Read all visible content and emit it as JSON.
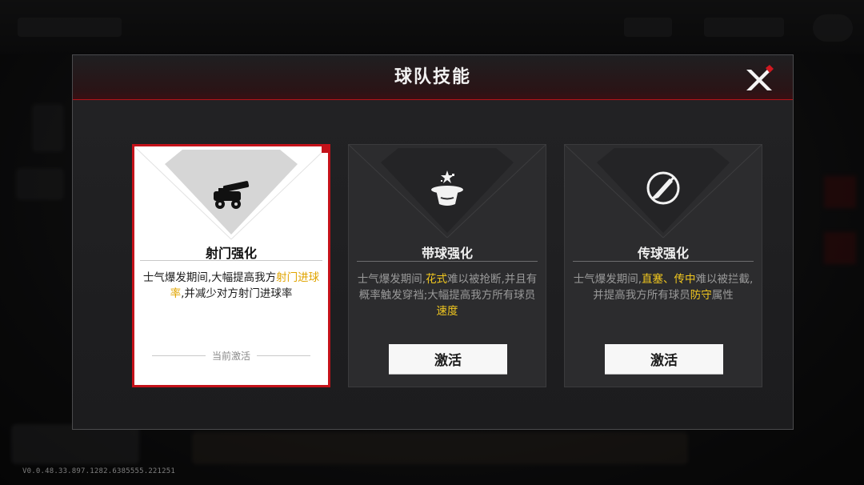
{
  "dialog": {
    "title": "球队技能"
  },
  "skills": [
    {
      "name": "射门强化",
      "icon": "cannon-icon",
      "state": "active",
      "desc_parts": [
        {
          "text": "士气爆发期间,大幅提高我方",
          "highlight": false
        },
        {
          "text": "射门进球率",
          "highlight": true
        },
        {
          "text": ",并减少对方射门进球率",
          "highlight": false
        }
      ],
      "status_label": "当前激活"
    },
    {
      "name": "带球强化",
      "icon": "magic-hat-icon",
      "state": "inactive",
      "desc_parts": [
        {
          "text": "士气爆发期间,",
          "highlight": false
        },
        {
          "text": "花式",
          "highlight": true
        },
        {
          "text": "难以被抢断,并且有概率触发穿裆;大幅提高我方所有球员",
          "highlight": false
        },
        {
          "text": "速度",
          "highlight": true
        }
      ],
      "button_label": "激活"
    },
    {
      "name": "传球强化",
      "icon": "no-pen-icon",
      "state": "inactive",
      "desc_parts": [
        {
          "text": "士气爆发期间,",
          "highlight": false
        },
        {
          "text": "直塞、传中",
          "highlight": true
        },
        {
          "text": "难以被拦截,并提高我方所有球员",
          "highlight": false
        },
        {
          "text": "防守",
          "highlight": true
        },
        {
          "text": "属性",
          "highlight": false
        }
      ],
      "button_label": "激活"
    }
  ],
  "footer": {
    "version": "V0.0.48.33.897.1282.6385555.221251"
  },
  "colors": {
    "accent_red": "#c4121a",
    "highlight_yellow": "#f2c81f",
    "card_dark": "#2c2c2e"
  }
}
